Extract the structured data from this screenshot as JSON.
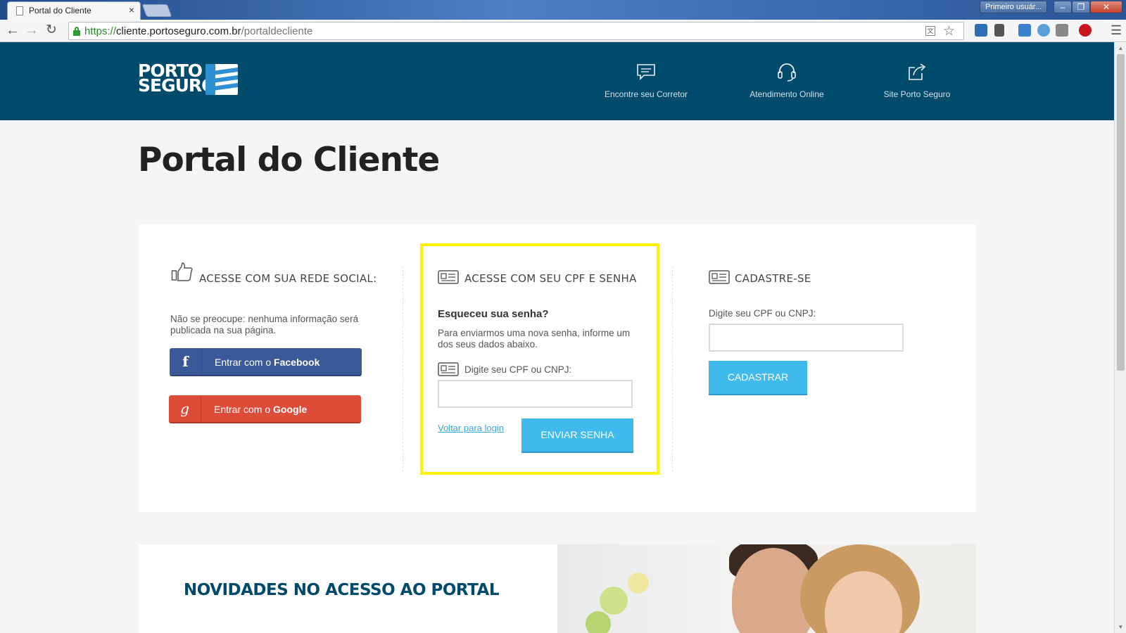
{
  "browser": {
    "tab_title": "Portal do Cliente",
    "tab_close": "×",
    "profile_label": "Primeiro usuár...",
    "window_min": "–",
    "window_max": "❐",
    "window_close": "✕",
    "url_scheme": "https://",
    "url_host": "cliente.portoseguro.com.br",
    "url_path": "/portaldecliente",
    "icons": [
      "back-arrow-icon",
      "forward-arrow-icon",
      "reload-icon",
      "lock-icon",
      "translate-icon",
      "star-icon",
      "menu-icon"
    ]
  },
  "header": {
    "logo_line1": "PORTO",
    "logo_line2": "SEGURO",
    "links": [
      {
        "label": "Encontre seu Corretor",
        "icon": "chat-bubble-icon"
      },
      {
        "label": "Atendimento Online",
        "icon": "headset-icon"
      },
      {
        "label": "Site Porto Seguro",
        "icon": "external-link-icon"
      }
    ]
  },
  "page": {
    "title": "Portal do Cliente"
  },
  "social": {
    "heading": "ACESSE COM SUA REDE SOCIAL:",
    "note": "Não se preocupe: nenhuma informação será publicada na sua página.",
    "facebook_prefix": "Entrar com o ",
    "facebook_brand": "Facebook",
    "facebook_glyph": "f",
    "google_prefix": "Entrar com o ",
    "google_brand": "Google",
    "google_glyph": "g"
  },
  "cpf_login": {
    "heading": "ACESSE COM SEU CPF E SENHA",
    "forgot_title": "Esqueceu sua senha?",
    "forgot_text": "Para enviarmos uma nova senha, informe um dos seus dados abaixo.",
    "field_label": "Digite seu CPF ou CNPJ:",
    "field_value": "",
    "back_link": "Voltar para login",
    "submit_label": "ENVIAR SENHA"
  },
  "register": {
    "heading": "CADASTRE-SE",
    "field_label": "Digite seu CPF ou CNPJ:",
    "field_value": "",
    "submit_label": "CADASTRAR"
  },
  "news": {
    "title": "NOVIDADES NO ACESSO AO PORTAL"
  },
  "colors": {
    "header_bg": "#004a6b",
    "accent_blue": "#40b9ec",
    "facebook": "#3b5998",
    "google": "#dd4b39",
    "highlight": "#fff200"
  }
}
